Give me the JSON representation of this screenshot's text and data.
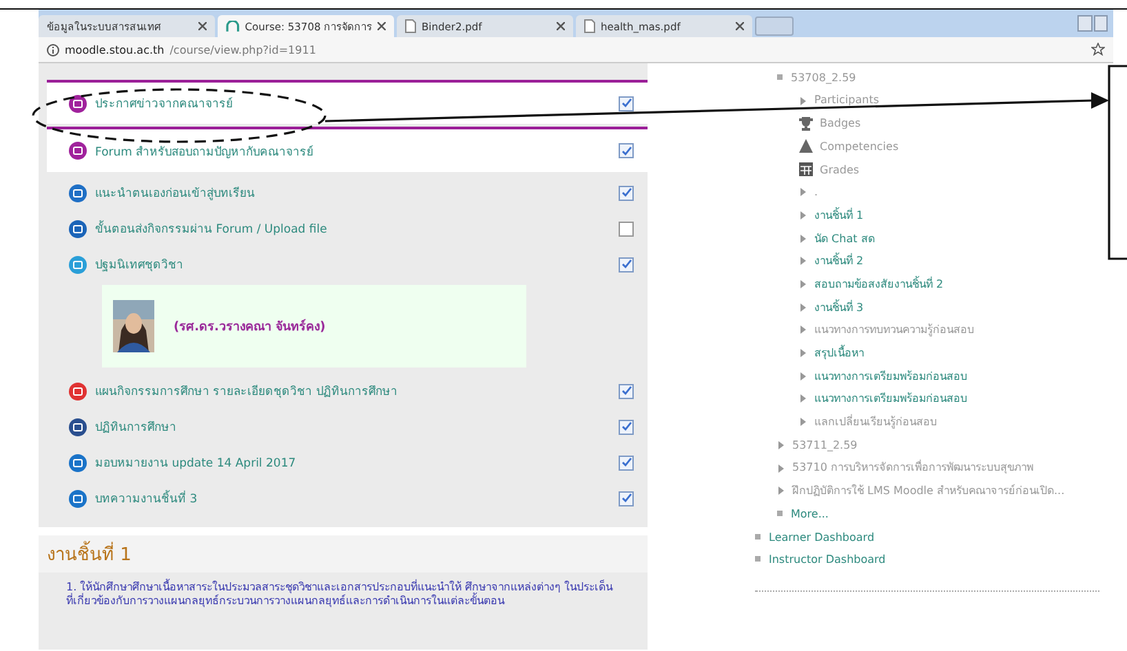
{
  "browser": {
    "tabs": [
      {
        "title": "ข้อมูลในระบบสารสนเทศ",
        "kind": "plain",
        "selected": false
      },
      {
        "title": "Course: 53708 การจัดการ",
        "kind": "site",
        "selected": true
      },
      {
        "title": "Binder2.pdf",
        "kind": "document",
        "selected": false
      },
      {
        "title": "health_mas.pdf",
        "kind": "document",
        "selected": false
      }
    ],
    "address": {
      "host": "moodle.stou.ac.th",
      "path": "/course/view.php?id=1911"
    }
  },
  "activities": [
    {
      "kind": "forum",
      "title": "ประกาศข่าวจากคณาจารย์",
      "highlighted": true,
      "completed": true
    },
    {
      "kind": "forum",
      "title": "Forum สำหรับสอบถามปัญหากับคณาจารย์",
      "highlighted": true,
      "completed": true
    },
    {
      "kind": "page",
      "title": "แนะนำตนเองก่อนเข้าสู่บทเรียน",
      "highlighted": false,
      "completed": true
    },
    {
      "kind": "assign",
      "title": "ขั้นตอนส่งกิจกรรมผ่าน Forum / Upload file",
      "highlighted": false,
      "completed": false
    },
    {
      "kind": "url",
      "title": "ปฐมนิเทศชุดวิชา",
      "highlighted": false,
      "completed": true
    },
    {
      "kind": "label",
      "teacher": "(รศ.ดร.วรางคณา  จันทร์คง)"
    },
    {
      "kind": "pdf",
      "title": "แผนกิจกรรมการศึกษา รายละเอียดชุดวิชา ปฏิทินการศึกษา",
      "highlighted": false,
      "completed": true
    },
    {
      "kind": "file",
      "title": "ปฏิทินการศึกษา",
      "highlighted": false,
      "completed": true
    },
    {
      "kind": "folder",
      "title": "มอบหมายงาน update 14 April 2017",
      "highlighted": false,
      "completed": true
    },
    {
      "kind": "folder",
      "title": "บทความงานชิ้นที่ 3",
      "highlighted": false,
      "completed": true
    }
  ],
  "section": {
    "title": "งานชิ้นที่ 1",
    "text": "1. ให้นักศึกษาศึกษาเนื้อหาสาระในประมวลสาระชุดวิชาและเอกสารประกอบที่แนะนำให้ ศึกษาจากแหล่งต่างๆ ในประเด็น ที่เกี่ยวข้องกับการวางแผนกลยุทธ์กระบวนการวางแผนกลยุทธ์และการดำเนินการในแต่ละขั้นตอน"
  },
  "sidebar": {
    "courses": [
      {
        "label": "53708_2.59",
        "kind": "bullet",
        "link": false,
        "children": [
          {
            "label": "Participants",
            "kind": "arrow",
            "link": false
          },
          {
            "label": "Badges",
            "kind": "trophy",
            "link": false
          },
          {
            "label": "Competencies",
            "kind": "competency",
            "link": false
          },
          {
            "label": "Grades",
            "kind": "table",
            "link": false
          },
          {
            "label": ".",
            "kind": "arrow",
            "link": false
          },
          {
            "label": "งานชิ้นที่ 1",
            "kind": "arrow",
            "link": true
          },
          {
            "label": "นัด Chat สด",
            "kind": "arrow",
            "link": true
          },
          {
            "label": "งานชิ้นที่ 2",
            "kind": "arrow",
            "link": true
          },
          {
            "label": "สอบถามข้อสงสัยงานชิ้นที่ 2",
            "kind": "arrow",
            "link": true
          },
          {
            "label": "งานชิ้นที่ 3",
            "kind": "arrow",
            "link": true
          },
          {
            "label": "แนวทางการทบทวนความรู้ก่อนสอบ",
            "kind": "arrow",
            "link": false
          },
          {
            "label": "สรุปเนื้อหา",
            "kind": "arrow",
            "link": true
          },
          {
            "label": "แนวทางการเตรียมพร้อมก่อนสอบ",
            "kind": "arrow",
            "link": true
          },
          {
            "label": "แนวทางการเตรียมพร้อมก่อนสอบ",
            "kind": "arrow",
            "link": true
          },
          {
            "label": "แลกเปลี่ยนเรียนรู้ก่อนสอบ",
            "kind": "arrow",
            "link": false
          }
        ]
      },
      {
        "label": "53711_2.59",
        "kind": "arrow",
        "link": false
      },
      {
        "label": "53710 การบริหารจัดการเพื่อการพัฒนาระบบสุขภาพ",
        "kind": "arrow",
        "link": false
      },
      {
        "label": "ฝึกปฏิบัติการใช้ LMS Moodle สำหรับคณาจารย์ก่อนเปิด...",
        "kind": "arrow",
        "link": false
      },
      {
        "label": "More...",
        "kind": "bullet",
        "link": true
      }
    ],
    "dashboards": [
      {
        "label": "Learner Dashboard"
      },
      {
        "label": "Instructor Dashboard"
      }
    ]
  }
}
